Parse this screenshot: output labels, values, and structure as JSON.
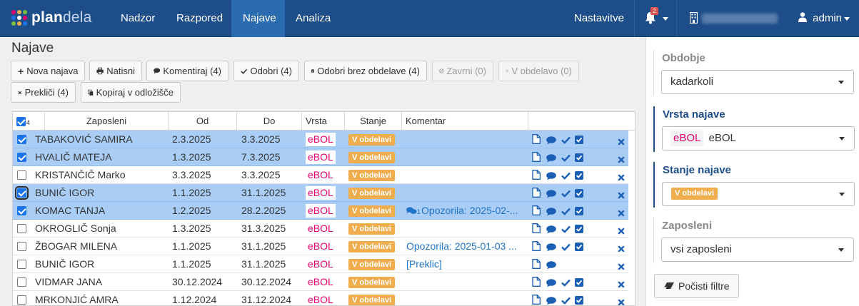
{
  "app": {
    "logo_bold": "plan",
    "logo_light": "dela",
    "logo_colors": [
      "#e5006d",
      "#f0ad4e",
      "#7fbf3f",
      "#1a73e8",
      "#ffffff",
      "#e5006d",
      "#7fbf3f",
      "#f0ad4e",
      "#1a73e8"
    ]
  },
  "nav": {
    "items": [
      "Nadzor",
      "Razpored",
      "Najave",
      "Analiza"
    ],
    "active": "Najave",
    "settings": "Nastavitve",
    "notification_count": "2",
    "company_icon": "building-icon",
    "user": "admin"
  },
  "page": {
    "title": "Najave"
  },
  "toolbar": {
    "buttons": [
      {
        "icon": "+",
        "label": "Nova najava",
        "enabled": true
      },
      {
        "icon": "print-icon",
        "label": "Natisni",
        "enabled": true
      },
      {
        "icon": "comment-icon",
        "label": "Komentiraj (4)",
        "enabled": true
      },
      {
        "icon": "check-icon",
        "label": "Odobri (4)",
        "enabled": true
      },
      {
        "icon": "checkbox-icon",
        "label": "Odobri brez obdelave (4)",
        "enabled": true
      },
      {
        "icon": "ban-icon",
        "label": "Zavrni (0)",
        "enabled": false
      },
      {
        "icon": "undo-icon",
        "label": "V obdelavo (0)",
        "enabled": false
      },
      {
        "icon": "times-icon",
        "label": "Prekliči (4)",
        "enabled": true
      },
      {
        "icon": "copy-icon",
        "label": "Kopiraj v odložišče",
        "enabled": true
      }
    ]
  },
  "table": {
    "selected_count": "4",
    "columns": [
      "Zaposleni",
      "Od",
      "Do",
      "Vrsta",
      "Stanje",
      "Komentar"
    ],
    "rows": [
      {
        "name": "TABAKOVIĆ SAMIRA",
        "od": "2.3.2025",
        "do": "3.3.2025",
        "vrsta": "eBOL",
        "stanje": "V obdelavi",
        "komentar": "",
        "selected": true,
        "focus": false,
        "actions": [
          "file",
          "comment",
          "check",
          "checkbox",
          "times"
        ]
      },
      {
        "name": "HVALIČ MATEJA",
        "od": "1.3.2025",
        "do": "7.3.2025",
        "vrsta": "eBOL",
        "stanje": "V obdelavi",
        "komentar": "",
        "selected": true,
        "focus": false,
        "actions": [
          "file",
          "comment",
          "check",
          "checkbox",
          "times"
        ]
      },
      {
        "name": "KRISTANČIČ Marko",
        "od": "3.3.2025",
        "do": "3.3.2025",
        "vrsta": "eBOL",
        "stanje": "V obdelavi",
        "komentar": "",
        "selected": false,
        "focus": false,
        "actions": [
          "file",
          "comment",
          "check",
          "checkbox",
          "times"
        ]
      },
      {
        "name": "BUNIČ IGOR",
        "od": "1.1.2025",
        "do": "31.1.2025",
        "vrsta": "eBOL",
        "stanje": "V obdelavi",
        "komentar": "",
        "selected": true,
        "focus": true,
        "actions": [
          "file",
          "comment",
          "check",
          "checkbox",
          "times"
        ]
      },
      {
        "name": "KOMAC TANJA",
        "od": "1.2.2025",
        "do": "28.2.2025",
        "vrsta": "eBOL",
        "stanje": "V obdelavi",
        "komentar": "Opozorila: 2025-02-...",
        "comment_count": "1",
        "selected": true,
        "focus": false,
        "actions": [
          "file",
          "comment",
          "check",
          "checkbox",
          "times"
        ]
      },
      {
        "name": "OKROGLIČ Sonja",
        "od": "1.3.2025",
        "do": "31.3.2025",
        "vrsta": "eBOL",
        "stanje": "V obdelavi",
        "komentar": "",
        "selected": false,
        "focus": false,
        "actions": [
          "file",
          "comment",
          "check",
          "checkbox",
          "times"
        ]
      },
      {
        "name": "ŽBOGAR MILENA",
        "od": "1.1.2025",
        "do": "31.1.2025",
        "vrsta": "eBOL",
        "stanje": "V obdelavi",
        "komentar": "Opozorila: 2025-01-03 ...",
        "selected": false,
        "focus": false,
        "actions": [
          "file",
          "comment",
          "check",
          "checkbox",
          "times"
        ]
      },
      {
        "name": "BUNIČ IGOR",
        "od": "1.1.2025",
        "do": "31.1.2025",
        "vrsta": "eBOL",
        "stanje": "V obdelavi",
        "komentar": "[Preklic]",
        "selected": false,
        "focus": false,
        "actions": [
          "file",
          "comment",
          "times"
        ]
      },
      {
        "name": "VIDMAR JANA",
        "od": "30.12.2024",
        "do": "30.12.2024",
        "vrsta": "eBOL",
        "stanje": "V obdelavi",
        "komentar": "",
        "selected": false,
        "focus": false,
        "actions": [
          "file",
          "comment",
          "check",
          "checkbox",
          "times"
        ]
      },
      {
        "name": "MRKONJIĆ AMRA",
        "od": "1.12.2024",
        "do": "31.12.2024",
        "vrsta": "eBOL",
        "stanje": "V obdelavi",
        "komentar": "",
        "selected": false,
        "focus": false,
        "actions": [
          "file",
          "comment",
          "check",
          "checkbox",
          "times"
        ]
      }
    ]
  },
  "filters": {
    "obdobje": {
      "label": "Obdobje",
      "value": "kadarkoli"
    },
    "vrsta": {
      "label": "Vrsta najave",
      "tag": "eBOL",
      "value": "eBOL"
    },
    "stanje": {
      "label": "Stanje najave",
      "value": "V obdelavi"
    },
    "zaposleni": {
      "label": "Zaposleni",
      "value": "vsi zaposleni"
    },
    "clear_label": "Počisti filtre"
  },
  "colors": {
    "navbar": "#1d4e8a",
    "nav_active": "#2b6cb0",
    "row_selected": "#aacdf6",
    "vrsta_text": "#e5006d",
    "stanje_badge": "#f0ad4e",
    "link": "#1f74c6",
    "action_icon": "#1a5fb4",
    "times_icon": "#1a5fb4"
  }
}
